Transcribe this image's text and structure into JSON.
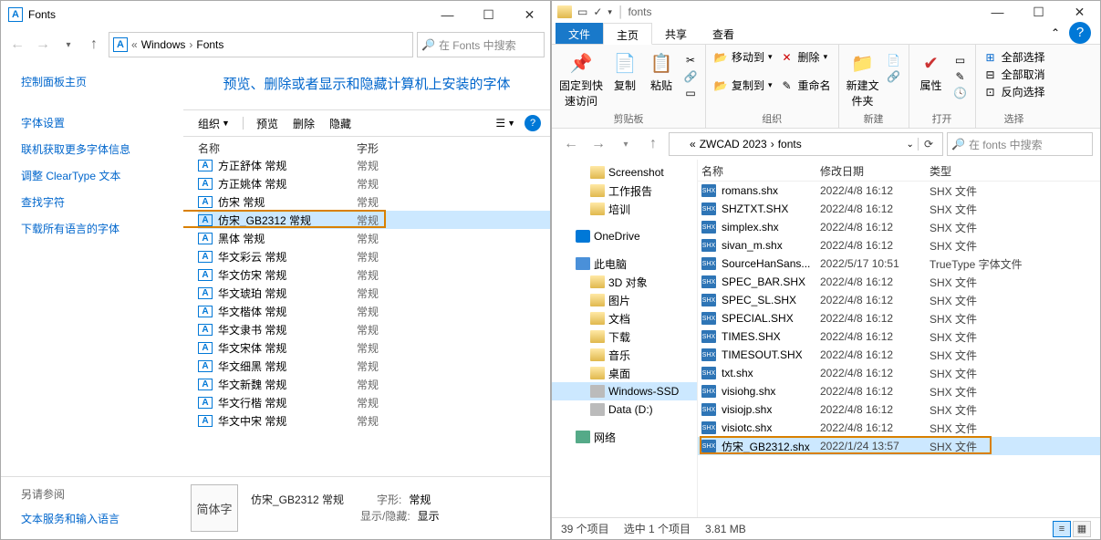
{
  "left": {
    "title": "Fonts",
    "address": {
      "seg1": "Windows",
      "seg2": "Fonts"
    },
    "search_placeholder": "在 Fonts 中搜索",
    "sidebar": {
      "header": "控制面板主页",
      "links": [
        "字体设置",
        "联机获取更多字体信息",
        "调整 ClearType 文本",
        "查找字符",
        "下载所有语言的字体"
      ]
    },
    "banner": "预览、删除或者显示和隐藏计算机上安装的字体",
    "toolbar": {
      "organize": "组织",
      "preview": "预览",
      "delete": "删除",
      "hide": "隐藏"
    },
    "columns": {
      "name": "名称",
      "shape": "字形"
    },
    "fonts": [
      {
        "name": "方正舒体 常规",
        "shape": "常规"
      },
      {
        "name": "方正姚体 常规",
        "shape": "常规"
      },
      {
        "name": "仿宋 常规",
        "shape": "常规"
      },
      {
        "name": "仿宋_GB2312 常规",
        "shape": "常规",
        "selected": true
      },
      {
        "name": "黑体 常规",
        "shape": "常规"
      },
      {
        "name": "华文彩云 常规",
        "shape": "常规"
      },
      {
        "name": "华文仿宋 常规",
        "shape": "常规"
      },
      {
        "name": "华文琥珀 常规",
        "shape": "常规"
      },
      {
        "name": "华文楷体 常规",
        "shape": "常规"
      },
      {
        "name": "华文隶书 常规",
        "shape": "常规"
      },
      {
        "name": "华文宋体 常规",
        "shape": "常规"
      },
      {
        "name": "华文细黑 常规",
        "shape": "常规"
      },
      {
        "name": "华文新魏 常规",
        "shape": "常规"
      },
      {
        "name": "华文行楷 常规",
        "shape": "常规"
      },
      {
        "name": "华文中宋 常规",
        "shape": "常规"
      }
    ],
    "bottom": {
      "seealso": "另请参阅",
      "link": "文本服务和输入语言",
      "thumb": "简体字",
      "name": "仿宋_GB2312 常规",
      "shape_k": "字形:",
      "shape_v": "常规",
      "show_k": "显示/隐藏:",
      "show_v": "显示"
    }
  },
  "right": {
    "win_title": "fonts",
    "tabs": {
      "file": "文件",
      "home": "主页",
      "share": "共享",
      "view": "查看"
    },
    "ribbon": {
      "clipboard": {
        "pin": "固定到快速访问",
        "copy": "复制",
        "paste": "粘贴",
        "cut_icon": "剪切",
        "label": "剪贴板"
      },
      "organize": {
        "moveto": "移动到",
        "copyto": "复制到",
        "delete": "删除",
        "rename": "重命名",
        "label": "组织"
      },
      "new": {
        "newfolder": "新建文件夹",
        "label": "新建"
      },
      "open": {
        "properties": "属性",
        "label": "打开"
      },
      "select": {
        "selectall": "全部选择",
        "selectnone": "全部取消",
        "invert": "反向选择",
        "label": "选择"
      }
    },
    "address": {
      "seg1": "ZWCAD 2023",
      "seg2": "fonts"
    },
    "search_placeholder": "在 fonts 中搜索",
    "tree": [
      {
        "label": "Screenshot",
        "cls": "",
        "indent": 2
      },
      {
        "label": "工作报告",
        "cls": "",
        "indent": 2
      },
      {
        "label": "培训",
        "cls": "",
        "indent": 2
      },
      {
        "spacer": true
      },
      {
        "label": "OneDrive",
        "cls": "onedrive",
        "indent": 1
      },
      {
        "spacer": true
      },
      {
        "label": "此电脑",
        "cls": "pc",
        "indent": 1
      },
      {
        "label": "3D 对象",
        "cls": "",
        "indent": 2
      },
      {
        "label": "图片",
        "cls": "",
        "indent": 2
      },
      {
        "label": "文档",
        "cls": "",
        "indent": 2
      },
      {
        "label": "下载",
        "cls": "",
        "indent": 2
      },
      {
        "label": "音乐",
        "cls": "",
        "indent": 2
      },
      {
        "label": "桌面",
        "cls": "",
        "indent": 2
      },
      {
        "label": "Windows-SSD",
        "cls": "drive",
        "selected": true,
        "indent": 2
      },
      {
        "label": "Data (D:)",
        "cls": "drive",
        "indent": 2
      },
      {
        "spacer": true
      },
      {
        "label": "网络",
        "cls": "net",
        "indent": 1
      }
    ],
    "cols": {
      "name": "名称",
      "date": "修改日期",
      "type": "类型"
    },
    "files": [
      {
        "name": "romans.shx",
        "date": "2022/4/8 16:12",
        "type": "SHX 文件"
      },
      {
        "name": "SHZTXT.SHX",
        "date": "2022/4/8 16:12",
        "type": "SHX 文件"
      },
      {
        "name": "simplex.shx",
        "date": "2022/4/8 16:12",
        "type": "SHX 文件"
      },
      {
        "name": "sivan_m.shx",
        "date": "2022/4/8 16:12",
        "type": "SHX 文件"
      },
      {
        "name": "SourceHanSans...",
        "date": "2022/5/17 10:51",
        "type": "TrueType 字体文件"
      },
      {
        "name": "SPEC_BAR.SHX",
        "date": "2022/4/8 16:12",
        "type": "SHX 文件"
      },
      {
        "name": "SPEC_SL.SHX",
        "date": "2022/4/8 16:12",
        "type": "SHX 文件"
      },
      {
        "name": "SPECIAL.SHX",
        "date": "2022/4/8 16:12",
        "type": "SHX 文件"
      },
      {
        "name": "TIMES.SHX",
        "date": "2022/4/8 16:12",
        "type": "SHX 文件"
      },
      {
        "name": "TIMESOUT.SHX",
        "date": "2022/4/8 16:12",
        "type": "SHX 文件"
      },
      {
        "name": "txt.shx",
        "date": "2022/4/8 16:12",
        "type": "SHX 文件"
      },
      {
        "name": "visiohg.shx",
        "date": "2022/4/8 16:12",
        "type": "SHX 文件"
      },
      {
        "name": "visiojp.shx",
        "date": "2022/4/8 16:12",
        "type": "SHX 文件"
      },
      {
        "name": "visiotc.shx",
        "date": "2022/4/8 16:12",
        "type": "SHX 文件"
      },
      {
        "name": "仿宋_GB2312.shx",
        "date": "2022/1/24 13:57",
        "type": "SHX 文件",
        "selected": true
      }
    ],
    "status": {
      "count": "39 个项目",
      "sel": "选中 1 个项目",
      "size": "3.81 MB"
    }
  }
}
